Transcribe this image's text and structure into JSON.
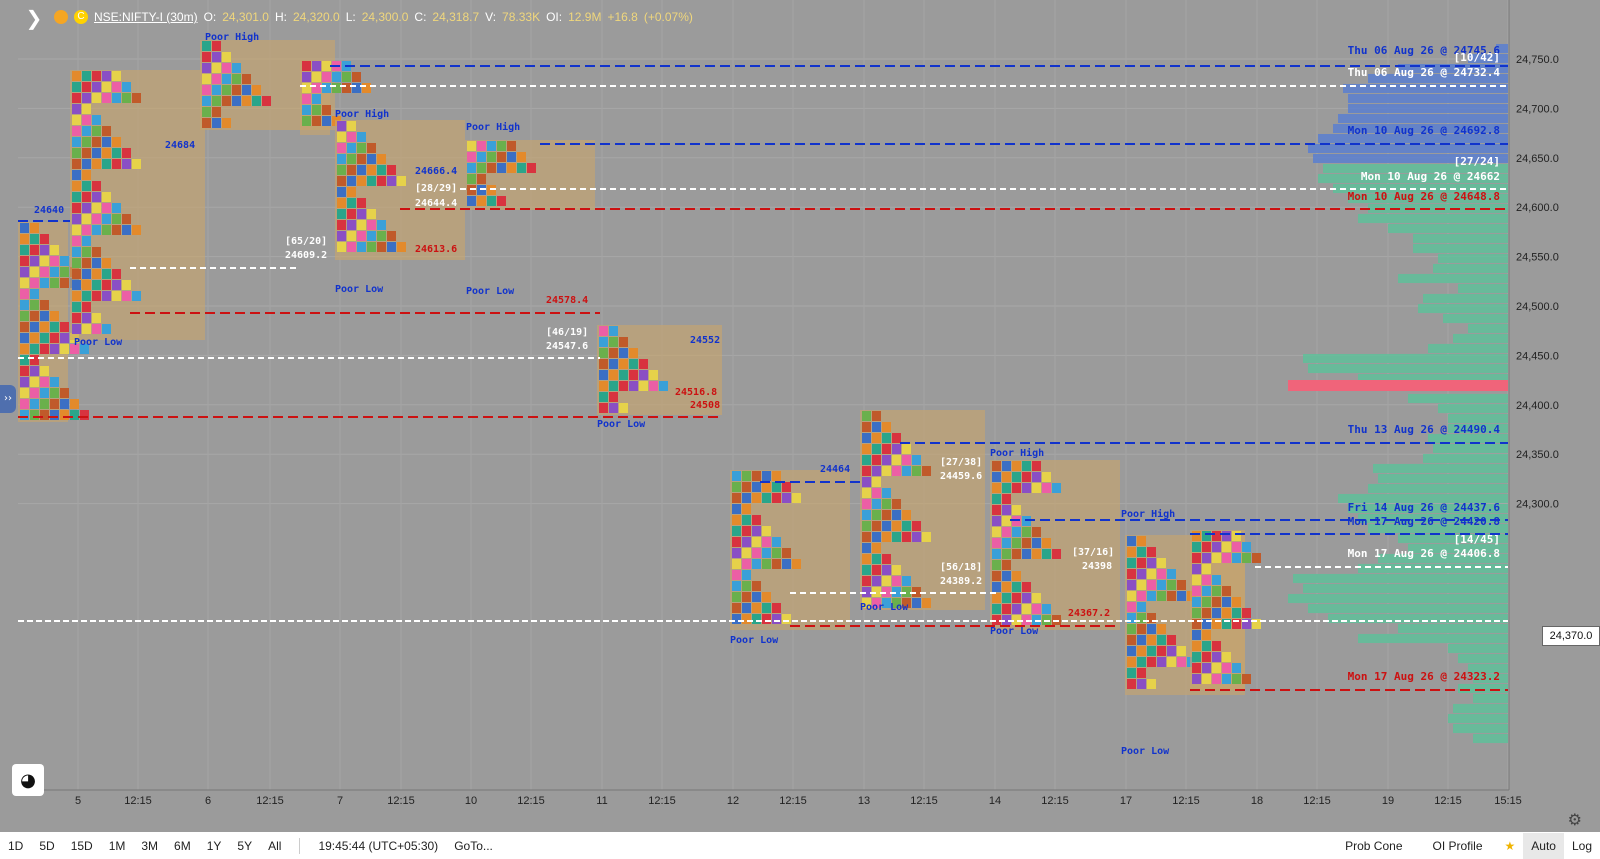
{
  "header": {
    "symbol": "NSE:NIFTY-I (30m)",
    "open_label": "O:",
    "open": "24,301.0",
    "high_label": "H:",
    "high": "24,320.0",
    "low_label": "L:",
    "low": "24,300.0",
    "close_label": "C:",
    "close": "24,318.7",
    "vol_label": "V:",
    "vol": "78.33K",
    "oi_label": "OI:",
    "oi": "12.9M",
    "change": "+16.8",
    "change_pct": "(+0.07%)",
    "accent_colors": [
      "#f5a623",
      "#ffd200"
    ]
  },
  "price_axis": {
    "ticks": [
      "24,750.0",
      "24,700.0",
      "24,650.0",
      "24,600.0",
      "24,550.0",
      "24,500.0",
      "24,450.0",
      "24,400.0",
      "24,350.0",
      "24,300.0"
    ],
    "current": "24,370.0"
  },
  "time_axis": {
    "ticks": [
      "5",
      "12:15",
      "6",
      "12:15",
      "7",
      "12:15",
      "10",
      "12:15",
      "11",
      "12:15",
      "12",
      "12:15",
      "13",
      "12:15",
      "14",
      "12:15",
      "17",
      "12:15",
      "18",
      "12:15",
      "19",
      "12:15",
      "15:15"
    ]
  },
  "annotations": {
    "right_labels": [
      {
        "text": "Thu 06 Aug 26 @ 24745.6",
        "color": "#1133cc"
      },
      {
        "text": "[10/42]",
        "color": "#ffffff"
      },
      {
        "text": "Thu 06 Aug 26 @ 24732.4",
        "color": "#ffffff"
      },
      {
        "text": "Mon 10 Aug 26 @ 24692.8",
        "color": "#1133cc"
      },
      {
        "text": "[27/24]",
        "color": "#ffffff"
      },
      {
        "text": "Mon 10 Aug 26 @ 24662",
        "color": "#ffffff"
      },
      {
        "text": "Mon 10 Aug 26 @ 24648.8",
        "color": "#cc1111"
      },
      {
        "text": "Thu 13 Aug 26 @ 24490.4",
        "color": "#1133cc"
      },
      {
        "text": "Fri 14 Aug 26 @ 24437.6",
        "color": "#1133cc"
      },
      {
        "text": "Mon 17 Aug 26 @ 24420.8",
        "color": "#1133cc"
      },
      {
        "text": "[14/45]",
        "color": "#ffffff"
      },
      {
        "text": "Mon 17 Aug 26 @ 24406.8",
        "color": "#ffffff"
      },
      {
        "text": "Mon 17 Aug 26 @ 24323.2",
        "color": "#cc1111"
      }
    ],
    "session_labels": [
      {
        "text": "24640",
        "color": "#1133cc"
      },
      {
        "text": "Poor Low",
        "color": "#1133cc"
      },
      {
        "text": "24684",
        "color": "#1133cc"
      },
      {
        "text": "Poor High",
        "color": "#1133cc"
      },
      {
        "text": "[65/20]",
        "color": "#ffffff"
      },
      {
        "text": "24609.2",
        "color": "#ffffff"
      },
      {
        "text": "Poor High",
        "color": "#1133cc"
      },
      {
        "text": "Poor Low",
        "color": "#1133cc"
      },
      {
        "text": "24666.4",
        "color": "#1133cc"
      },
      {
        "text": "[28/29]",
        "color": "#ffffff"
      },
      {
        "text": "24644.4",
        "color": "#ffffff"
      },
      {
        "text": "24613.6",
        "color": "#cc1111"
      },
      {
        "text": "Poor High",
        "color": "#1133cc"
      },
      {
        "text": "Poor Low",
        "color": "#1133cc"
      },
      {
        "text": "24578.4",
        "color": "#cc1111"
      },
      {
        "text": "[46/19]",
        "color": "#ffffff"
      },
      {
        "text": "24547.6",
        "color": "#ffffff"
      },
      {
        "text": "24552",
        "color": "#1133cc"
      },
      {
        "text": "24516.8",
        "color": "#cc1111"
      },
      {
        "text": "24508",
        "color": "#cc1111"
      },
      {
        "text": "Poor Low",
        "color": "#1133cc"
      },
      {
        "text": "24464",
        "color": "#1133cc"
      },
      {
        "text": "Poor Low",
        "color": "#1133cc"
      },
      {
        "text": "[27/38]",
        "color": "#ffffff"
      },
      {
        "text": "24459.6",
        "color": "#ffffff"
      },
      {
        "text": "Poor Low",
        "color": "#1133cc"
      },
      {
        "text": "[56/18]",
        "color": "#ffffff"
      },
      {
        "text": "24389.2",
        "color": "#ffffff"
      },
      {
        "text": "Poor High",
        "color": "#1133cc"
      },
      {
        "text": "Poor Low",
        "color": "#1133cc"
      },
      {
        "text": "[37/16]",
        "color": "#ffffff"
      },
      {
        "text": "24398",
        "color": "#ffffff"
      },
      {
        "text": "24367.2",
        "color": "#cc1111"
      },
      {
        "text": "Poor High",
        "color": "#1133cc"
      },
      {
        "text": "Poor Low",
        "color": "#1133cc"
      }
    ]
  },
  "bottom": {
    "ranges": [
      "1D",
      "5D",
      "15D",
      "1M",
      "3M",
      "6M",
      "1Y",
      "5Y",
      "All"
    ],
    "clock": "19:45:44 (UTC+05:30)",
    "goto": "GoTo...",
    "prob_cone": "Prob Cone",
    "oi_profile": "OI Profile",
    "auto": "Auto",
    "log": "Log"
  }
}
